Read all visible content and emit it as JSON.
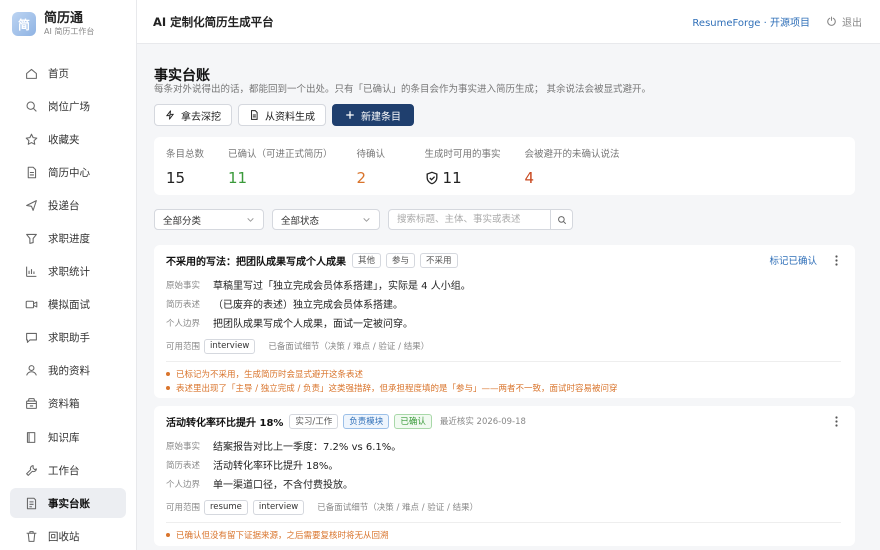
{
  "brand": {
    "name": "简历通",
    "sub": "AI 简历工作台",
    "logo_char": "简"
  },
  "sidebar": {
    "items": [
      {
        "label": "首页",
        "icon": "home-icon"
      },
      {
        "label": "岗位广场",
        "icon": "search-icon"
      },
      {
        "label": "收藏夹",
        "icon": "star-icon"
      },
      {
        "label": "简历中心",
        "icon": "document-icon"
      },
      {
        "label": "投递台",
        "icon": "send-icon"
      },
      {
        "label": "求职进度",
        "icon": "funnel-icon"
      },
      {
        "label": "求职统计",
        "icon": "chart-icon"
      },
      {
        "label": "模拟面试",
        "icon": "video-icon"
      },
      {
        "label": "求职助手",
        "icon": "chat-icon"
      },
      {
        "label": "我的资料",
        "icon": "user-icon"
      },
      {
        "label": "资料箱",
        "icon": "box-icon"
      },
      {
        "label": "知识库",
        "icon": "book-icon"
      },
      {
        "label": "工作台",
        "icon": "wrench-icon"
      },
      {
        "label": "事实台账",
        "icon": "ledger-icon",
        "active": true
      },
      {
        "label": "回收站",
        "icon": "trash-icon"
      }
    ]
  },
  "header": {
    "title": "AI 定制化简历生成平台",
    "link": "ResumeForge · 开源项目",
    "logout": "退出"
  },
  "page": {
    "title": "事实台账",
    "desc": "每条对外说得出的话，都能回到一个出处。只有「已确认」的条目会作为事实进入简历生成； 其余说法会被显式避开。"
  },
  "toolbar": {
    "dig": "拿去深挖",
    "from_material": "从资料生成",
    "new_entry": "新建条目"
  },
  "stats": [
    {
      "label": "条目总数",
      "value": "15",
      "color": "#222"
    },
    {
      "label": "已确认（可进正式简历）",
      "value": "11",
      "color": "#3a9a3a"
    },
    {
      "label": "待确认",
      "value": "2",
      "color": "#d9742c"
    },
    {
      "label": "生成时可用的事实",
      "value": "11",
      "color": "#222",
      "icon": true
    },
    {
      "label": "会被避开的未确认说法",
      "value": "4",
      "color": "#c9481f"
    }
  ],
  "filters": {
    "category": "全部分类",
    "status": "全部状态",
    "search_placeholder": "搜索标题、主体、事实或表述"
  },
  "cards": [
    {
      "title": "不采用的写法：把团队成果写成个人成果",
      "tags": [
        "其他",
        "参与",
        "不采用"
      ],
      "action": "标记已确认",
      "rows": [
        {
          "label": "原始事实",
          "value": "草稿里写过「独立完成会员体系搭建」，实际是 4 人小组。"
        },
        {
          "label": "简历表述",
          "value": "（已废弃的表述）独立完成会员体系搭建。"
        },
        {
          "label": "个人边界",
          "value": "把团队成果写成个人成果，面试一定被问穿。"
        }
      ],
      "scope_label": "可用范围",
      "scope_tags": [
        "interview"
      ],
      "scope_note": "已备面试细节（决策 / 难点 / 验证 / 结果）",
      "warnings": [
        "已标记为不采用，生成简历时会显式避开这条表述",
        "表述里出现了「主导 / 独立完成 / 负责」这类强措辞，但承担程度填的是「参与」——两者不一致，面试时容易被问穿"
      ]
    },
    {
      "title": "活动转化率环比提升 18%",
      "tags": [
        "实习/工作",
        "负责模块",
        "已确认"
      ],
      "meta": "最近核实 2026-09-18",
      "rows": [
        {
          "label": "原始事实",
          "value": "结案报告对比上一季度：7.2% vs 6.1%。"
        },
        {
          "label": "简历表述",
          "value": "活动转化率环比提升 18%。"
        },
        {
          "label": "个人边界",
          "value": "单一渠道口径，不含付费投放。"
        }
      ],
      "scope_label": "可用范围",
      "scope_tags": [
        "resume",
        "interview"
      ],
      "scope_note": "已备面试细节（决策 / 难点 / 验证 / 结果）",
      "warnings": [
        "已确认但没有留下证据来源，之后需要复核时将无从回溯"
      ]
    }
  ]
}
